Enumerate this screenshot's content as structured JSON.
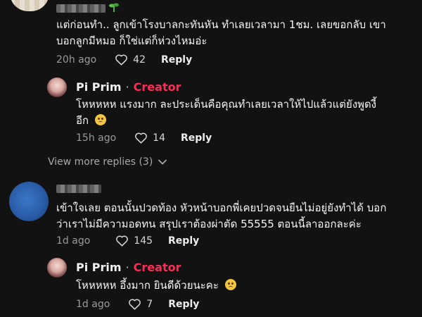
{
  "comments": [
    {
      "text_line1": "แต่ก่อนทำ.. ลูกเข้าโรงบาลกะทันหัน ทำเลยเวลามา 1ชม. เลยขอกลับ เขา",
      "text_line2": "บอกลูกมีหมอ ก็ใช่แต่ก็ห่วงไหมอ่ะ",
      "time": "20h ago",
      "likes": "42",
      "reply": "Reply",
      "reply_item": {
        "name": "Pi Prim",
        "separator": "·",
        "badge": "Creator",
        "text_line1": "โหหหหห แรงมาก ละประเด็นคือคุณทำเลยเวลาให้ไปแล้วแต่ยังพูดงี้",
        "text_line2": "อีก",
        "time": "15h ago",
        "likes": "14",
        "reply": "Reply"
      },
      "view_more": "View more replies (3)"
    },
    {
      "text_line1": "เข้าใจเลย ตอนนั้นปวดท้อง หัวหน้าบอกพี่เคยปวดจนยืนไม่อยู่ยังทำได้ บอก",
      "text_line2": "ว่าเราไม่มีความอดทน สรุปเราต้องผ่าตัด 55555 ตอนนี้ลาออกละค่ะ",
      "time": "1d ago",
      "likes": "145",
      "reply": "Reply",
      "reply_item": {
        "name": "Pi Prim",
        "separator": "·",
        "badge": "Creator",
        "text_line1": "โหหหหห อึ้งมาก ยินดีด้วยนะคะ",
        "time": "1d ago",
        "likes": "7",
        "reply": "Reply"
      }
    }
  ],
  "icons": {
    "like": "heart-outline-icon",
    "expand": "chevron-down-icon",
    "emoji": "sad-face-emoji-icon"
  },
  "colors": {
    "background": "#121212",
    "creator_badge": "#fe2c55",
    "meta_text": "#9a9a9a"
  }
}
